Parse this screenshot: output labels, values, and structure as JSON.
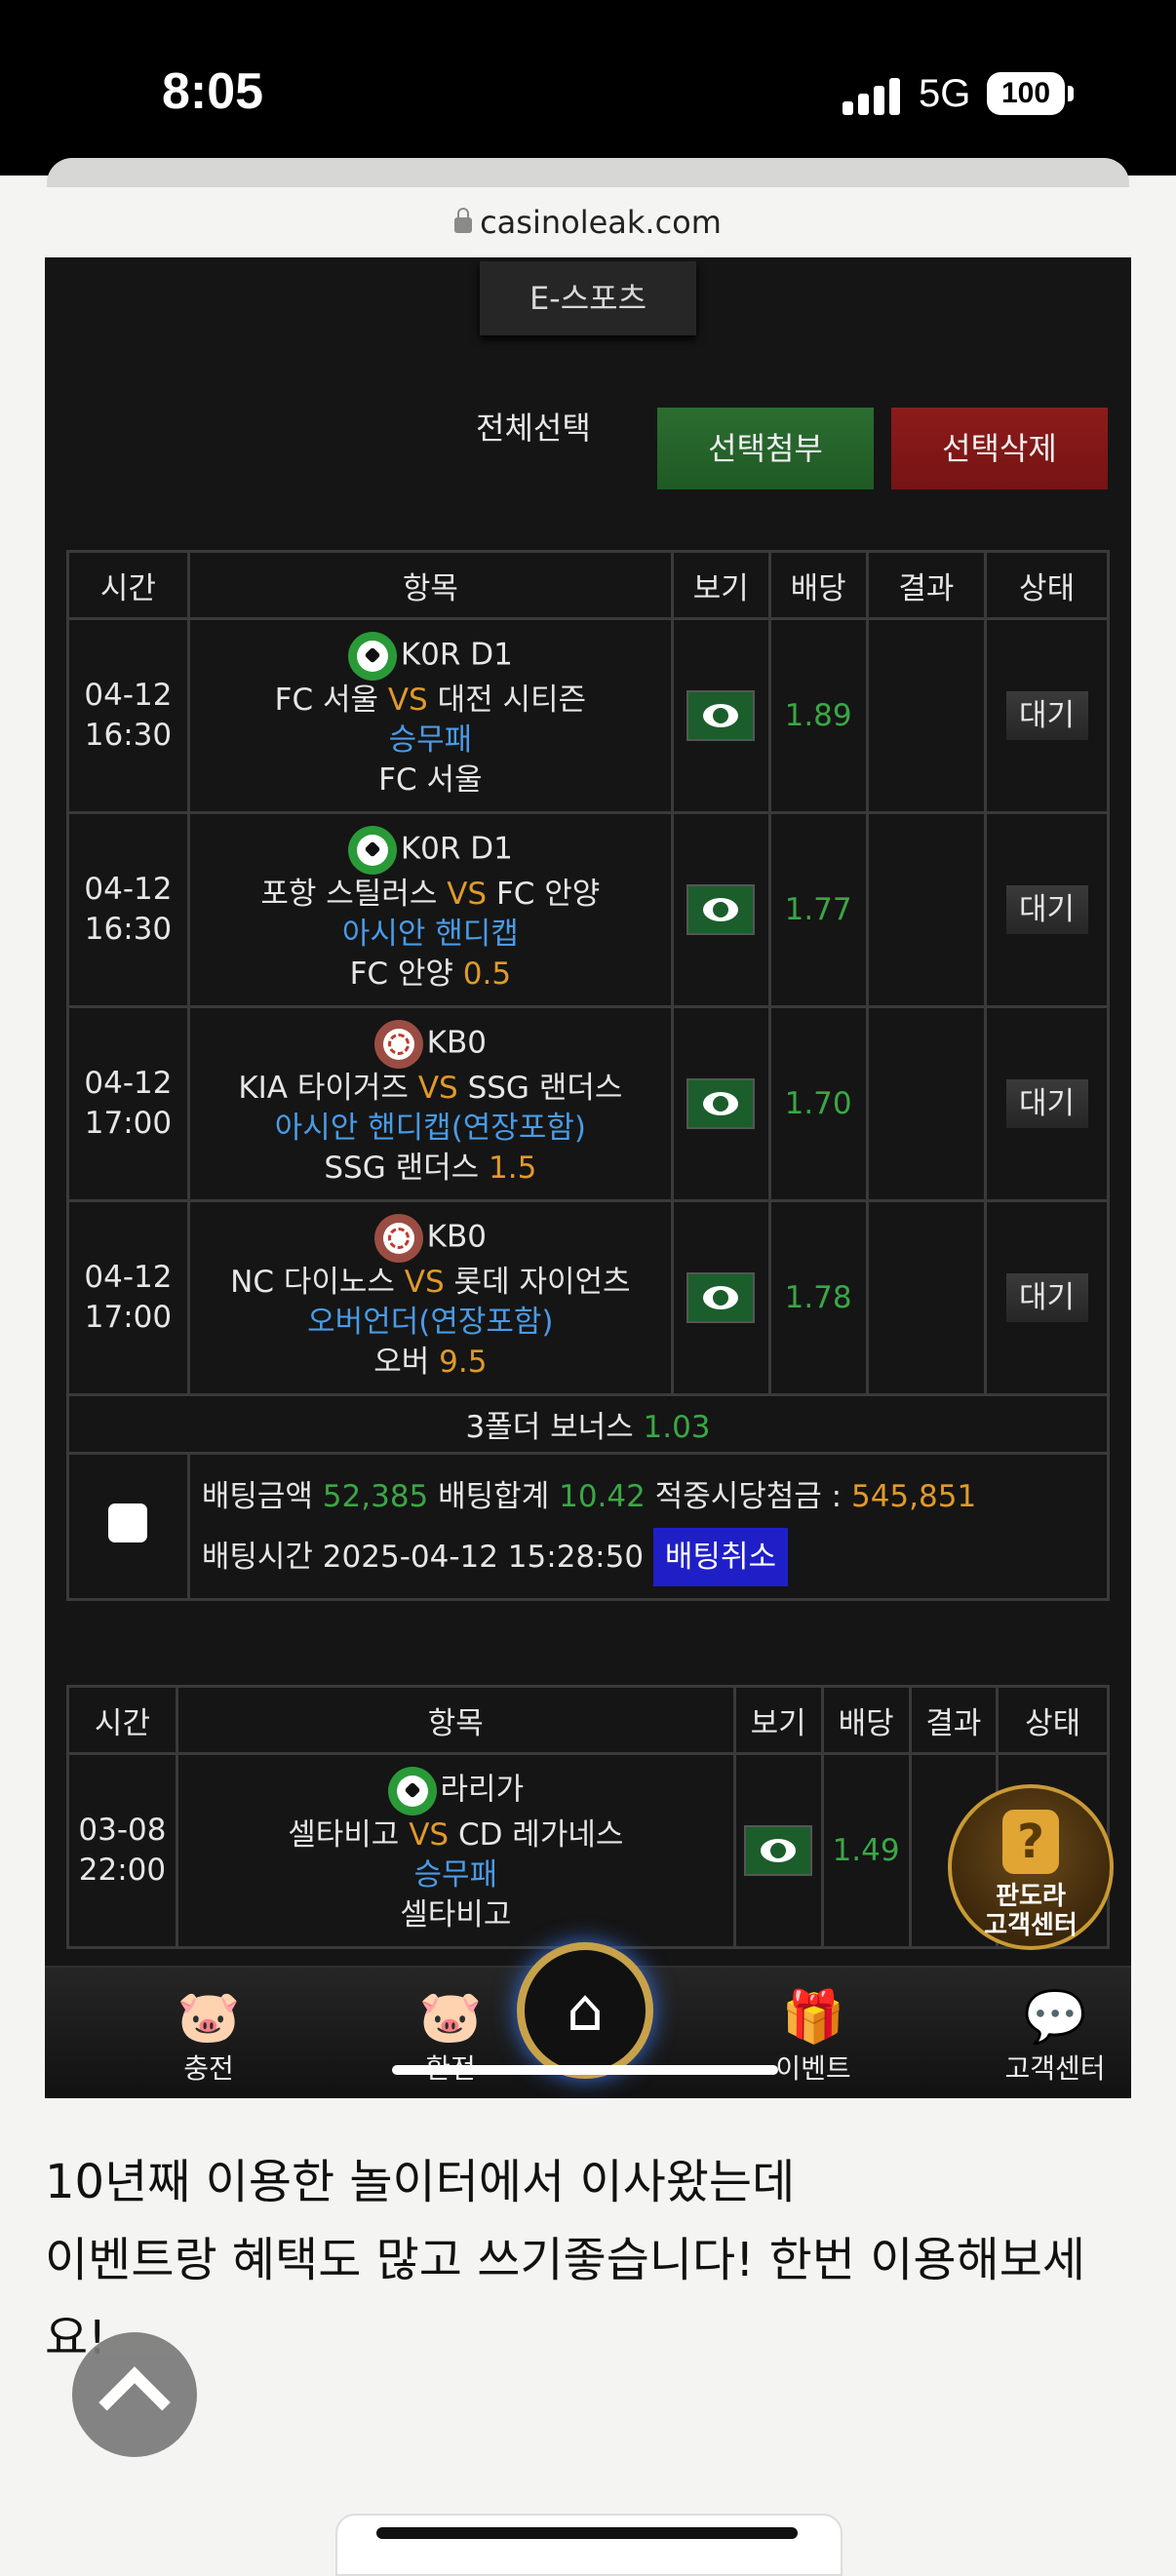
{
  "status": {
    "time": "8:05",
    "network": "5G",
    "battery": "100"
  },
  "browser": {
    "url": "casinoleak.com"
  },
  "page": {
    "category_tab": "E-스포츠",
    "select_all": "전체선택",
    "attach_selected": "선택첨부",
    "delete_selected": "선택삭제"
  },
  "table_headers": {
    "time": "시간",
    "item": "항목",
    "view": "보기",
    "odds": "배당",
    "result": "결과",
    "status": "상태"
  },
  "bets": [
    {
      "date": "04-12",
      "time": "16:30",
      "league": "K0R D1",
      "home": "FC 서울",
      "vs": "VS",
      "away": "대전 시티즌",
      "market": "승무패",
      "pick": "FC 서울",
      "line": "",
      "odds": "1.89",
      "status": "대기"
    },
    {
      "date": "04-12",
      "time": "16:30",
      "league": "K0R D1",
      "home": "포항 스틸러스",
      "vs": "VS",
      "away": "FC 안양",
      "market": "아시안 핸디캡",
      "pick": "FC 안양",
      "line": "0.5",
      "odds": "1.77",
      "status": "대기"
    },
    {
      "date": "04-12",
      "time": "17:00",
      "league": "KB0",
      "home": "KIA 타이거즈",
      "vs": "VS",
      "away": "SSG 랜더스",
      "market": "아시안 핸디캡(연장포함)",
      "pick": "SSG 랜더스",
      "line": "1.5",
      "odds": "1.70",
      "status": "대기"
    },
    {
      "date": "04-12",
      "time": "17:00",
      "league": "KB0",
      "home": "NC 다이노스",
      "vs": "VS",
      "away": "롯데 자이언츠",
      "market": "오버언더(연장포함)",
      "pick": "오버",
      "line": "9.5",
      "odds": "1.78",
      "status": "대기"
    }
  ],
  "bonus": {
    "label": "3폴더 보너스",
    "value": "1.03"
  },
  "summary": {
    "amount_label": "배팅금액",
    "amount": "52,385",
    "total_label": "배팅합계",
    "total": "10.42",
    "payout_label": "적중시당첨금 :",
    "payout": "545,851",
    "time_label": "배팅시간",
    "time": "2025-04-12 15:28:50",
    "cancel": "배팅취소"
  },
  "bet2": {
    "date": "03-08",
    "time": "22:00",
    "league": "라리가",
    "home": "셀타비고",
    "vs": "VS",
    "away": "CD 레가네스",
    "market": "승무패",
    "pick": "셀타비고",
    "odds": "1.49"
  },
  "support_badge": {
    "line1": "판도라",
    "line2": "고객센터"
  },
  "bottom_nav": {
    "charge": "충전",
    "withdraw": "환전",
    "event": "이벤트",
    "support": "고객센터"
  },
  "article": {
    "line1": "10년째 이용한 놀이터에서 이사왔는데",
    "line2": "이벤트랑 혜택도 많고 쓰기좋습니다! 한번 이용해보세요!"
  }
}
